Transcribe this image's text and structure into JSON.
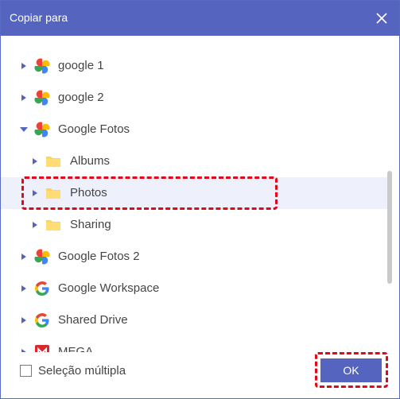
{
  "dialog": {
    "title": "Copiar para",
    "close_icon": "close-icon"
  },
  "tree": {
    "items": [
      {
        "label": "google 1",
        "icon": "google-photos-icon",
        "expanded": false,
        "level": 0
      },
      {
        "label": "google 2",
        "icon": "google-photos-icon",
        "expanded": false,
        "level": 0
      },
      {
        "label": "Google Fotos",
        "icon": "google-photos-icon",
        "expanded": true,
        "level": 0
      },
      {
        "label": "Albums",
        "icon": "folder-icon",
        "expanded": false,
        "level": 1
      },
      {
        "label": "Photos",
        "icon": "folder-icon",
        "expanded": false,
        "level": 1,
        "selected": true
      },
      {
        "label": "Sharing",
        "icon": "folder-icon",
        "expanded": false,
        "level": 1
      },
      {
        "label": "Google Fotos 2",
        "icon": "google-photos-icon",
        "expanded": false,
        "level": 0
      },
      {
        "label": "Google Workspace",
        "icon": "google-g-icon",
        "expanded": false,
        "level": 0
      },
      {
        "label": "Shared Drive",
        "icon": "google-g-icon",
        "expanded": false,
        "level": 0
      },
      {
        "label": "MEGA",
        "icon": "mega-icon",
        "expanded": false,
        "level": 0
      }
    ]
  },
  "footer": {
    "multi_select_label": "Seleção múltipla",
    "multi_select_checked": false,
    "ok_label": "OK"
  },
  "colors": {
    "accent": "#5565bf",
    "highlight": "#e0091a",
    "selected_row": "#eef1fb",
    "folder": "#ffd35c"
  }
}
